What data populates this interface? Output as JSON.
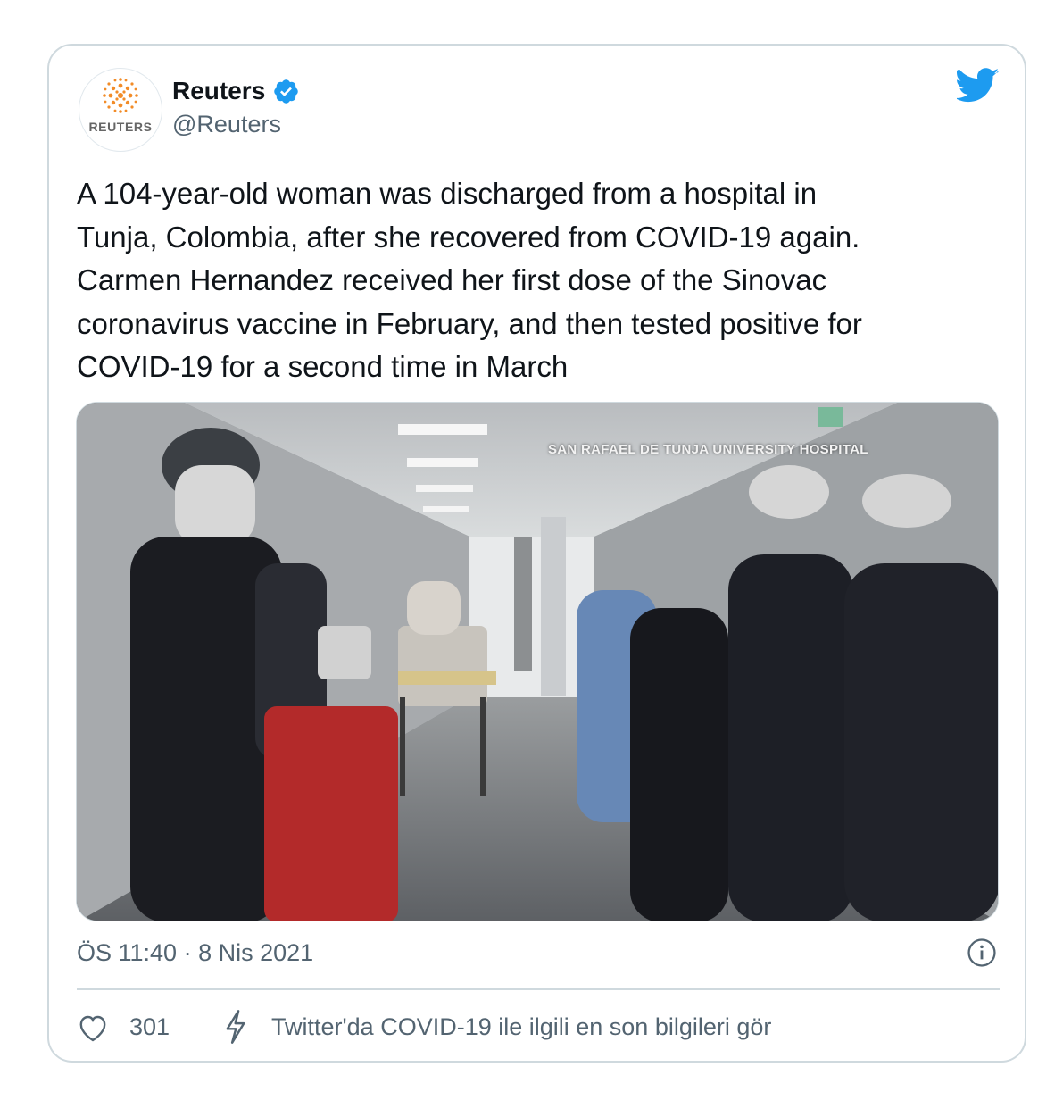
{
  "tweet": {
    "author": {
      "name": "Reuters",
      "handle": "@Reuters",
      "avatar_text": "REUTERS",
      "verified": true,
      "icon": "verified-badge-icon"
    },
    "text": "A 104-year-old woman was discharged from a hospital in\nTunja, Colombia, after she recovered from COVID-19 again.\nCarmen Hernandez received her first dose of the Sinovac\ncoronavirus vaccine in February, and then tested positive for\nCOVID-19 for a second time in March",
    "media": {
      "caption": "SAN RAFAEL DE TUNJA UNIVERSITY HOSPITAL",
      "kind": "video-still"
    },
    "timestamp": "ÖS 11:40 · 8 Nis 2021",
    "likes": "301",
    "covid_link": "Twitter'da COVID-19 ile ilgili en son bilgileri gör"
  },
  "colors": {
    "brand_blue": "#1d9bf0",
    "text_primary": "#0f1419",
    "text_secondary": "#536471",
    "border": "#cfd9de",
    "reuters_orange": "#f28c28"
  },
  "icons": [
    "twitter-bird-icon",
    "verified-badge-icon",
    "info-icon",
    "heart-icon",
    "bolt-icon",
    "reuters-logo"
  ]
}
